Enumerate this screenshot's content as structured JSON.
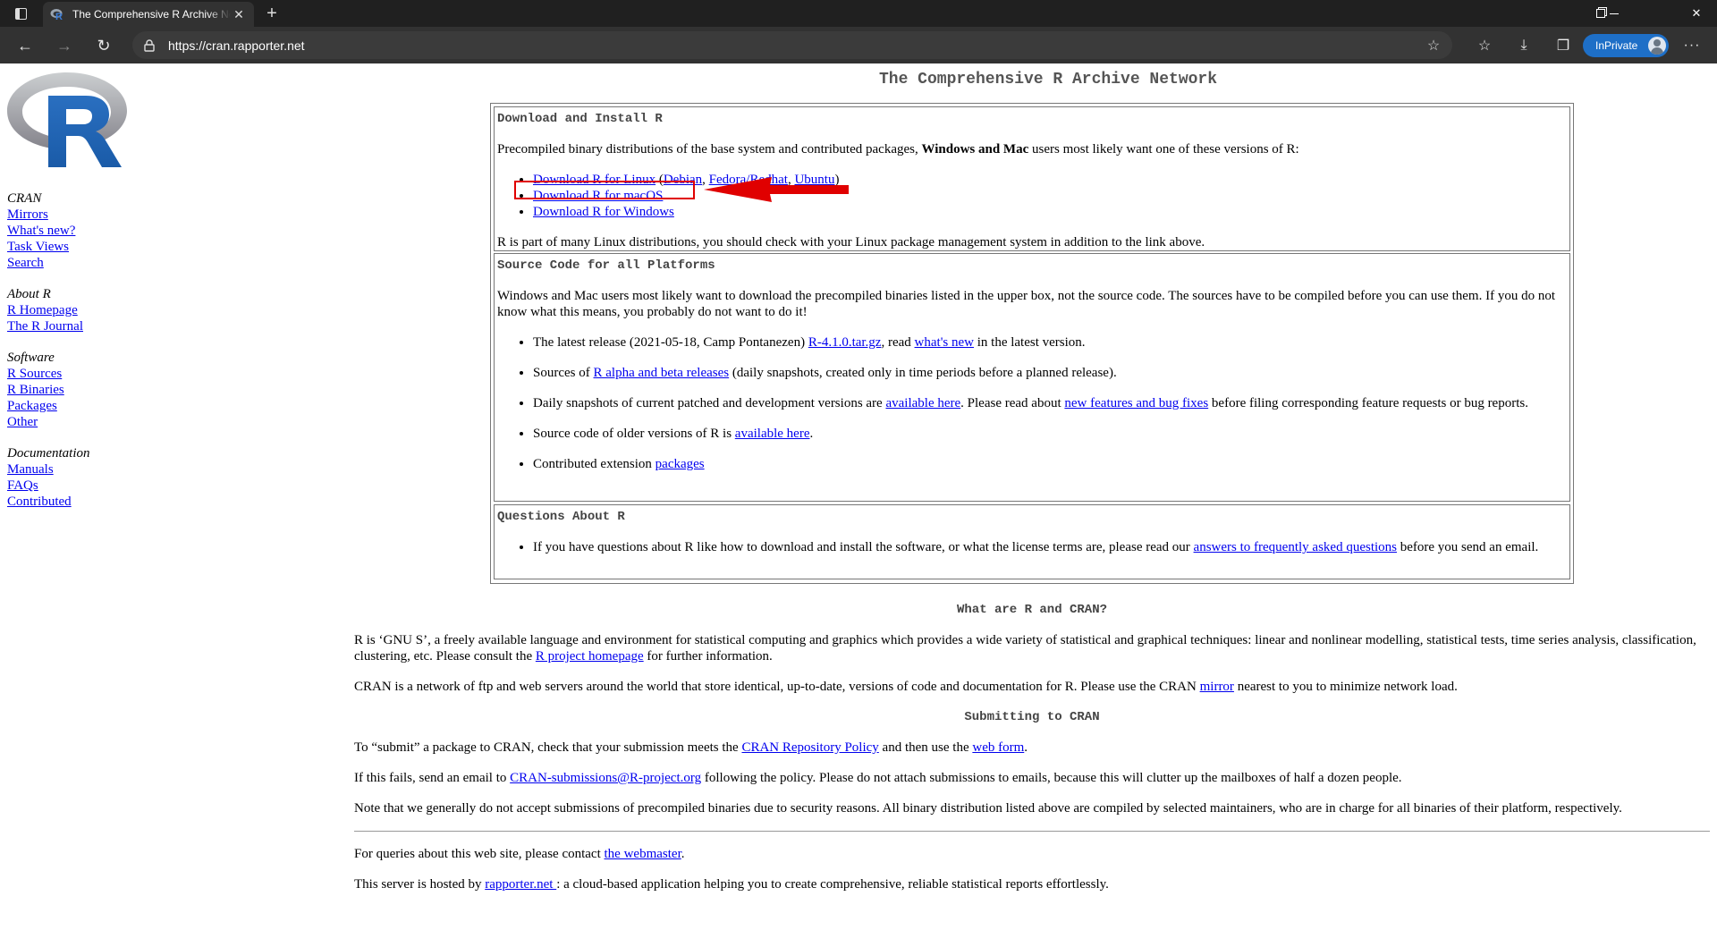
{
  "browser": {
    "tab_title": "The Comprehensive R Archive Network",
    "url": "https://cran.rapporter.net",
    "inprivate_label": "InPrivate",
    "icons": [
      "tab-actions-icon",
      "refresh-icon",
      "back-icon",
      "forward-icon",
      "lock-icon",
      "add-favorite-icon",
      "favorites-icon",
      "downloads-icon",
      "collections-icon",
      "more-icon",
      "minimize-icon",
      "maximize-icon",
      "close-icon"
    ]
  },
  "sidebar": {
    "groups": [
      {
        "head": "CRAN",
        "links": [
          "Mirrors",
          "What's new?",
          "Task Views",
          "Search"
        ]
      },
      {
        "head": "About R",
        "links": [
          "R Homepage",
          "The R Journal"
        ]
      },
      {
        "head": "Software",
        "links": [
          "R Sources",
          "R Binaries",
          "Packages",
          "Other"
        ]
      },
      {
        "head": "Documentation",
        "links": [
          "Manuals",
          "FAQs",
          "Contributed"
        ]
      }
    ]
  },
  "main": {
    "title": "The Comprehensive R Archive Network",
    "download": {
      "heading": "Download and Install R",
      "intro_a": "Precompiled binary distributions of the base system and contributed packages, ",
      "intro_bold": "Windows and Mac",
      "intro_b": " users most likely want one of these versions of R:",
      "linux": "Download R for Linux",
      "linux_open": " (",
      "debian": "Debian",
      "comma1": ", ",
      "fedora": "Fedora/Redhat",
      "comma2": ", ",
      "ubuntu": "Ubuntu",
      "linux_close": ")",
      "macos": "Download R for macOS",
      "windows": "Download R for Windows",
      "note": "R is part of many Linux distributions, you should check with your Linux package management system in addition to the link above."
    },
    "source": {
      "heading": "Source Code for all Platforms",
      "intro": "Windows and Mac users most likely want to download the precompiled binaries listed in the upper box, not the source code. The sources have to be compiled before you can use them. If you do not know what this means, you probably do not want to do it!",
      "latest_a": "The latest release (2021-05-18, Camp Pontanezen) ",
      "latest_link": "R-4.1.0.tar.gz",
      "latest_b": ", read ",
      "latest_link2": "what's new",
      "latest_c": " in the latest version.",
      "alpha_a": "Sources of ",
      "alpha_link": "R alpha and beta releases",
      "alpha_b": " (daily snapshots, created only in time periods before a planned release).",
      "daily_a": "Daily snapshots of current patched and development versions are ",
      "daily_link": "available here",
      "daily_b": ". Please read about ",
      "daily_link2": "new features and bug fixes",
      "daily_c": " before filing corresponding feature requests or bug reports.",
      "older_a": "Source code of older versions of R is ",
      "older_link": "available here",
      "older_b": ".",
      "contrib_a": "Contributed extension ",
      "contrib_link": "packages"
    },
    "questions": {
      "heading": "Questions About R",
      "text_a": "If you have questions about R like how to download and install the software, or what the license terms are, please read our ",
      "link": "answers to frequently asked questions",
      "text_b": " before you send an email."
    },
    "what": {
      "heading": "What are R and CRAN?",
      "p1_a": "R is ‘GNU S’, a freely available language and environment for statistical computing and graphics which provides a wide variety of statistical and graphical techniques: linear and nonlinear modelling, statistical tests, time series analysis, classification, clustering, etc. Please consult the ",
      "p1_link": "R project homepage",
      "p1_b": " for further information.",
      "p2_a": "CRAN is a network of ftp and web servers around the world that store identical, up-to-date, versions of code and documentation for R. Please use the CRAN ",
      "p2_link": "mirror",
      "p2_b": " nearest to you to minimize network load."
    },
    "submit": {
      "heading": "Submitting to CRAN",
      "p1_a": "To “submit” a package to CRAN, check that your submission meets the ",
      "p1_link": "CRAN Repository Policy",
      "p1_b": " and then use the ",
      "p1_link2": "web form",
      "p1_c": ".",
      "p2_a": "If this fails, send an email to ",
      "p2_link": "CRAN-submissions@R-project.org",
      "p2_b": " following the policy. Please do not attach submissions to emails, because this will clutter up the mailboxes of half a dozen people.",
      "p3": "Note that we generally do not accept submissions of precompiled binaries due to security reasons. All binary distribution listed above are compiled by selected maintainers, who are in charge for all binaries of their platform, respectively."
    },
    "footer": {
      "p1_a": "For queries about this web site, please contact ",
      "p1_link": "the webmaster",
      "p1_b": ".",
      "p2_a": "This server is hosted by ",
      "p2_link": "rapporter.net ",
      "p2_b": ": a cloud-based application helping you to create comprehensive, reliable statistical reports effortlessly."
    }
  },
  "colors": {
    "link": "#0000ee",
    "highlight": "#e00000",
    "chrome_dark": "#202020",
    "chrome_toolbar": "#323232",
    "inprivate": "#1e6fc7"
  }
}
